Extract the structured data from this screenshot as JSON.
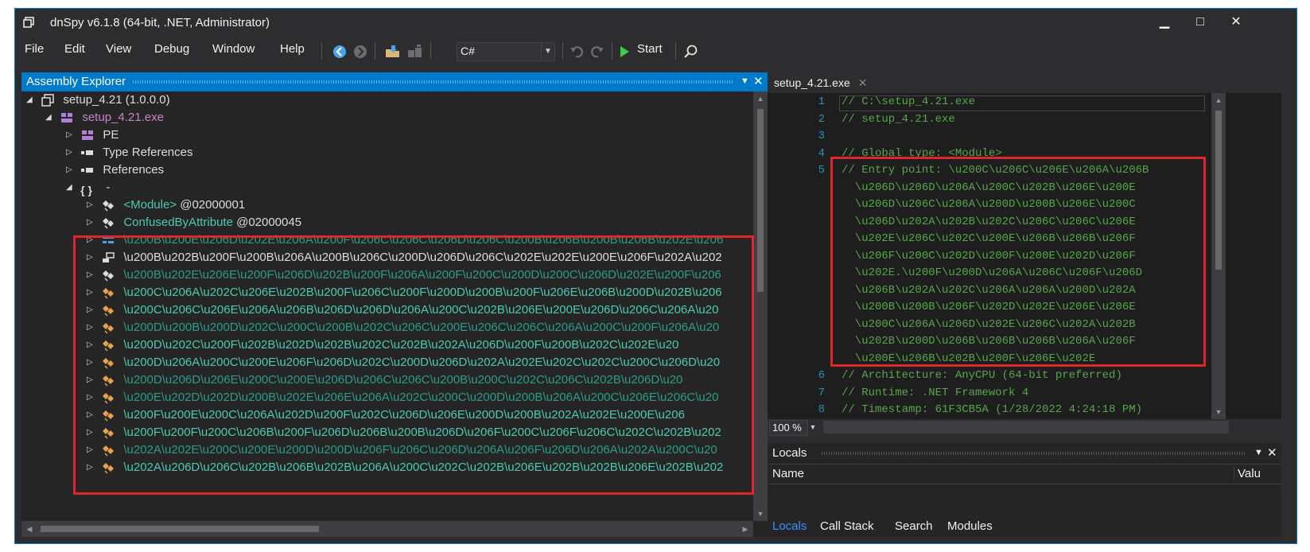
{
  "window": {
    "title": "dnSpy v6.1.8 (64-bit, .NET, Administrator)",
    "controls": {
      "minimize": "▁",
      "maximize": "□",
      "close": "✕"
    }
  },
  "menu": [
    "File",
    "Edit",
    "View",
    "Debug",
    "Window",
    "Help"
  ],
  "toolbar": {
    "language": "C#",
    "start_label": "Start"
  },
  "assembly_explorer": {
    "title": "Assembly Explorer",
    "tree": [
      {
        "text": "setup_4.21 (1.0.0.0)",
        "color": "gray"
      },
      {
        "text": "setup_4.21.exe",
        "color": "purple"
      },
      {
        "text": "PE",
        "color": "gray"
      },
      {
        "text": "Type References",
        "color": "gray"
      },
      {
        "text": "References",
        "color": "gray"
      },
      {
        "text": "-",
        "color": "gray"
      },
      {
        "text": "<Module>",
        "suffix": " @02000001",
        "color": "green"
      },
      {
        "text": "ConfusedByAttribute",
        "suffix": " @02000045",
        "color": "green"
      },
      {
        "text": "\\u200B\\u200E\\u206D\\u202E\\u206A\\u200F\\u206C\\u206C\\u206D\\u206C\\u200B\\u206B\\u200B\\u206B\\u202E\\u206",
        "color": "dimgreen"
      },
      {
        "text": "\\u200B\\u202B\\u200F\\u200B\\u206A\\u200B\\u206C\\u200D\\u206D\\u206C\\u202E\\u202E\\u200E\\u206F\\u202A\\u202",
        "color": "gray"
      },
      {
        "text": "\\u200B\\u202E\\u206E\\u200F\\u206D\\u202B\\u200F\\u206A\\u200F\\u200C\\u200D\\u200C\\u206D\\u202E\\u200F\\u206",
        "color": "dimgreen"
      },
      {
        "text": "\\u200C\\u206A\\u202C\\u206E\\u202B\\u200F\\u206C\\u200F\\u200D\\u200B\\u200F\\u206E\\u206B\\u200D\\u202B\\u206",
        "color": "green"
      },
      {
        "text": "\\u200C\\u206C\\u206E\\u206A\\u206B\\u206D\\u206D\\u206A\\u200C\\u202B\\u206E\\u200E\\u206D\\u206C\\u206A\\u20",
        "color": "green"
      },
      {
        "text": "\\u200D\\u200B\\u200D\\u202C\\u200C\\u200B\\u202C\\u206C\\u200E\\u206C\\u206C\\u206A\\u200C\\u200F\\u206A\\u20",
        "color": "dimgreen"
      },
      {
        "text": "\\u200D\\u202C\\u200F\\u202B\\u202D\\u202B\\u202C\\u202B\\u202A\\u206D\\u200F\\u200B\\u202C\\u202E\\u20",
        "color": "green"
      },
      {
        "text": "\\u200D\\u206A\\u200C\\u200E\\u206F\\u206D\\u202C\\u200D\\u206D\\u202A\\u202E\\u202C\\u202C\\u200C\\u206D\\u20",
        "color": "green"
      },
      {
        "text": "\\u200D\\u206D\\u206E\\u200C\\u200E\\u206D\\u206C\\u206C\\u200B\\u200C\\u202C\\u206C\\u202B\\u206D\\u20",
        "color": "dimgreen"
      },
      {
        "text": "\\u200E\\u202D\\u202D\\u200B\\u202E\\u206E\\u206A\\u202C\\u200C\\u200D\\u200B\\u206A\\u200C\\u206E\\u206C\\u20",
        "color": "dimgreen"
      },
      {
        "text": "\\u200F\\u200E\\u200C\\u206A\\u202D\\u200F\\u202C\\u206D\\u206E\\u200D\\u200B\\u202A\\u202E\\u200E\\u206",
        "color": "green"
      },
      {
        "text": "\\u200F\\u200F\\u200C\\u206B\\u200F\\u206D\\u206B\\u200B\\u206D\\u206F\\u200C\\u206F\\u206C\\u202C\\u202B\\u202",
        "color": "green"
      },
      {
        "text": "\\u202A\\u202E\\u200C\\u200E\\u200D\\u200D\\u206F\\u206C\\u206D\\u206A\\u206F\\u206D\\u206A\\u202A\\u200C\\u20",
        "color": "dimgreen"
      },
      {
        "text": "\\u202A\\u206D\\u206C\\u202B\\u206B\\u202B\\u206A\\u200C\\u202C\\u202B\\u206E\\u202B\\u202B\\u206E\\u202B\\u202",
        "color": "green"
      }
    ]
  },
  "editor": {
    "tab_label": "setup_4.21.exe",
    "zoom": "100 %",
    "lines": [
      {
        "num": "1",
        "text": "// C:\\setup_4.21.exe"
      },
      {
        "num": "2",
        "text": "// setup_4.21.exe"
      },
      {
        "num": "3",
        "text": ""
      },
      {
        "num": "4",
        "text": "// Global type: <Module>"
      },
      {
        "num": "5",
        "text": "// Entry point: \\u200C\\u206C\\u206E\\u206A\\u206B"
      },
      {
        "num": "",
        "text": "  \\u206D\\u206D\\u206A\\u200C\\u202B\\u206E\\u200E"
      },
      {
        "num": "",
        "text": "  \\u206D\\u206C\\u206A\\u200D\\u200B\\u206E\\u200C"
      },
      {
        "num": "",
        "text": "  \\u206D\\u202A\\u202B\\u202C\\u206C\\u206C\\u206E"
      },
      {
        "num": "",
        "text": "  \\u202E\\u206C\\u202C\\u200E\\u206B\\u206B\\u206F"
      },
      {
        "num": "",
        "text": "  \\u206F\\u200C\\u202D\\u200F\\u200E\\u202D\\u206F"
      },
      {
        "num": "",
        "text": "  \\u202E.\\u200F\\u200D\\u206A\\u206C\\u206F\\u206D"
      },
      {
        "num": "",
        "text": "  \\u206B\\u202A\\u202C\\u206A\\u206A\\u200D\\u202A"
      },
      {
        "num": "",
        "text": "  \\u200B\\u200B\\u206F\\u202D\\u202E\\u206E\\u206E"
      },
      {
        "num": "",
        "text": "  \\u200C\\u206A\\u206D\\u202E\\u206C\\u202A\\u202B"
      },
      {
        "num": "",
        "text": "  \\u202B\\u200D\\u206B\\u206B\\u206B\\u206A\\u206F"
      },
      {
        "num": "",
        "text": "  \\u200E\\u206B\\u202B\\u200F\\u206E\\u202E"
      },
      {
        "num": "6",
        "text": "// Architecture: AnyCPU (64-bit preferred)"
      },
      {
        "num": "7",
        "text": "// Runtime: .NET Framework 4"
      },
      {
        "num": "8",
        "text": "// Timestamp: 61F3CB5A (1/28/2022 4:24:18 PM)"
      }
    ]
  },
  "locals": {
    "title": "Locals",
    "col_name": "Name",
    "col_value": "Valu",
    "tabs": [
      "Locals",
      "Call Stack",
      "Search",
      "Modules"
    ]
  }
}
